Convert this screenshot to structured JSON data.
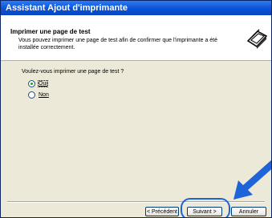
{
  "window": {
    "title": "Assistant Ajout d'imprimante"
  },
  "header": {
    "title": "Imprimer une page de test",
    "subtitle": "Vous pouvez imprimer une page de test afin de confirmer que l'imprimante a été installée correctement."
  },
  "content": {
    "question": "Voulez-vous imprimer une page de test ?",
    "options": [
      {
        "label": "Oui",
        "selected": true
      },
      {
        "label": "Non",
        "selected": false
      }
    ]
  },
  "buttons": {
    "back_label": "< Précédent",
    "next_label": "Suivant >",
    "cancel_label": "Annuler"
  },
  "colors": {
    "titlebar": "#0a52d6",
    "annotation_blue": "#1e63d8",
    "dialog_bg": "#ece9d8"
  },
  "icons": {
    "header_icon": "printer-wizard-icon",
    "annotation": "pointer-arrow-icon"
  }
}
